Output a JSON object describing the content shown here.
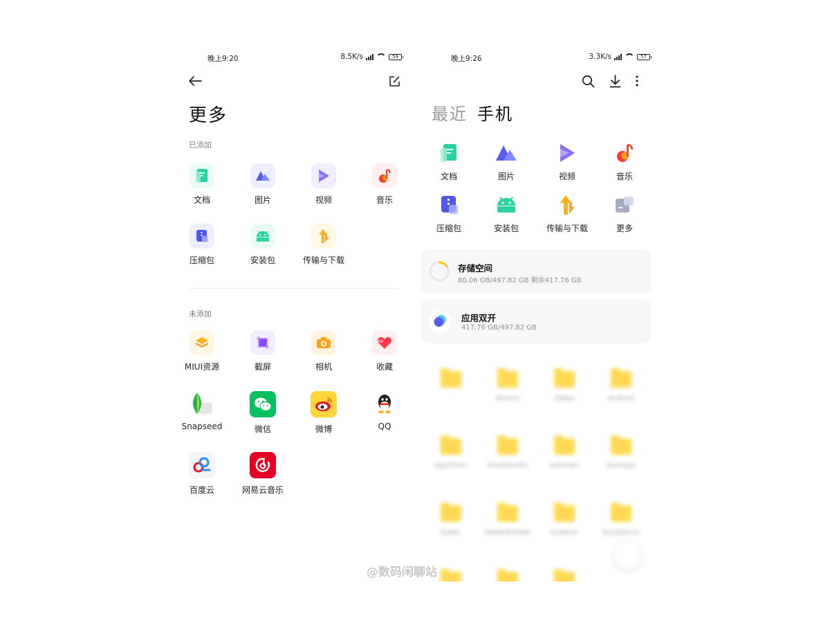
{
  "left": {
    "status": {
      "time": "晚上9:20",
      "speed": "8.5K/s",
      "battery": "59"
    },
    "title": "更多",
    "added_label": "已添加",
    "not_added_label": "未添加",
    "added": [
      {
        "label": "文档",
        "icon": "document-icon"
      },
      {
        "label": "图片",
        "icon": "picture-icon"
      },
      {
        "label": "视频",
        "icon": "video-icon"
      },
      {
        "label": "音乐",
        "icon": "music-icon"
      },
      {
        "label": "压缩包",
        "icon": "archive-icon"
      },
      {
        "label": "安装包",
        "icon": "android-icon"
      },
      {
        "label": "传输与下载",
        "icon": "transfer-icon"
      }
    ],
    "not_added": [
      {
        "label": "MIUI资源",
        "icon": "miui-resource-icon"
      },
      {
        "label": "截屏",
        "icon": "screenshot-icon"
      },
      {
        "label": "相机",
        "icon": "camera-icon"
      },
      {
        "label": "收藏",
        "icon": "favorite-icon"
      },
      {
        "label": "Snapseed",
        "icon": "snapseed-icon"
      },
      {
        "label": "微信",
        "icon": "wechat-icon"
      },
      {
        "label": "微博",
        "icon": "weibo-icon"
      },
      {
        "label": "QQ",
        "icon": "qq-icon"
      },
      {
        "label": "百度云",
        "icon": "baidu-cloud-icon"
      },
      {
        "label": "网易云音乐",
        "icon": "netease-music-icon"
      }
    ]
  },
  "right": {
    "status": {
      "time": "晚上9:26",
      "speed": "3.3K/s",
      "battery": "57"
    },
    "tab_recent": "最近",
    "tab_phone": "手机",
    "categories": [
      {
        "label": "文档",
        "icon": "document-icon"
      },
      {
        "label": "图片",
        "icon": "picture-icon"
      },
      {
        "label": "视频",
        "icon": "video-icon"
      },
      {
        "label": "音乐",
        "icon": "music-icon"
      },
      {
        "label": "压缩包",
        "icon": "archive-icon"
      },
      {
        "label": "安装包",
        "icon": "android-icon"
      },
      {
        "label": "传输与下载",
        "icon": "transfer-icon"
      },
      {
        "label": "更多",
        "icon": "more-icon"
      }
    ],
    "storage": {
      "title": "存储空间",
      "detail": "80.06 GB/497.82 GB  剩余417.76 GB",
      "used_fraction": 0.16
    },
    "dual_app": {
      "title": "应用双开",
      "detail": "417.76 GB/497.82 GB"
    },
    "folders": [
      "·",
      "Alarms",
      "alipay",
      "Android",
      "AppTimer",
      "Audiobooks",
      "autonavi",
      "backups",
      "baidu",
      "BaiduNetdisk",
      "browser",
      "ByteDance"
    ]
  },
  "watermark": "@数码闲聊站",
  "colors": {
    "accent_teal": "#2ad1a3",
    "accent_blue": "#5a5cf0",
    "accent_purple": "#8a6cf5",
    "music_red": "#ff3b30",
    "folder_yellow": "#ffd84a"
  }
}
